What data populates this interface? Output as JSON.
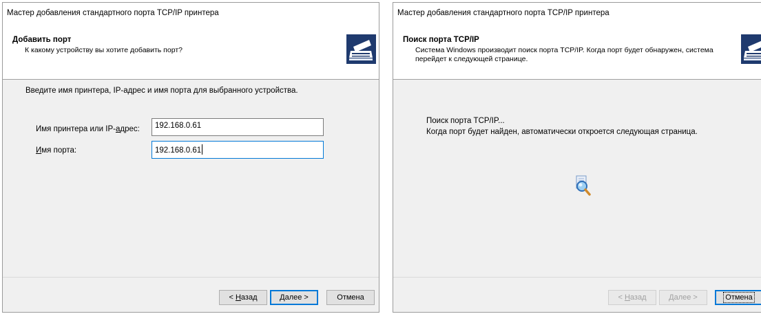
{
  "left": {
    "window_title": "Мастер добавления стандартного порта TCP/IP принтера",
    "header_title": "Добавить порт",
    "header_subtitle": "К какому устройству вы хотите добавить порт?",
    "instruction": "Введите имя принтера, IP-адрес и имя порта для выбранного устройства.",
    "printer_label_pre": "Имя принтера или IP-",
    "printer_label_u": "а",
    "printer_label_post": "дрес:",
    "printer_value": "192.168.0.61",
    "port_label_u": "И",
    "port_label_post": "мя порта:",
    "port_value": "192.168.0.61",
    "buttons": {
      "back_pre": "< ",
      "back_u": "Н",
      "back_post": "азад",
      "next_u": "Д",
      "next_post": "алее >",
      "cancel": "Отмена"
    }
  },
  "right": {
    "window_title": "Мастер добавления стандартного порта TCP/IP принтера",
    "header_title": "Поиск порта TCP/IP",
    "header_subtitle_line1": "Система Windows производит поиск порта TCP/IP. Когда порт будет обнаружен, система",
    "header_subtitle_line2": "перейдет к следующей странице.",
    "status_line1": "Поиск порта TCP/IP...",
    "status_line2": "Когда порт будет найден, автоматически откроется следующая страница.",
    "buttons": {
      "back_pre": "< ",
      "back_u": "Н",
      "back_post": "азад",
      "next_u": "Д",
      "next_post": "алее >",
      "cancel": "Отмена",
      "back_state": "disabled",
      "next_state": "disabled"
    }
  },
  "icons": {
    "wizard": "printer-wizard-icon",
    "search": "magnifier-search-icon"
  },
  "colors": {
    "dialog_bg": "#f0f0f0",
    "header_bg": "#ffffff",
    "accent": "#0078d7",
    "icon_bg": "#1f3a6e"
  }
}
